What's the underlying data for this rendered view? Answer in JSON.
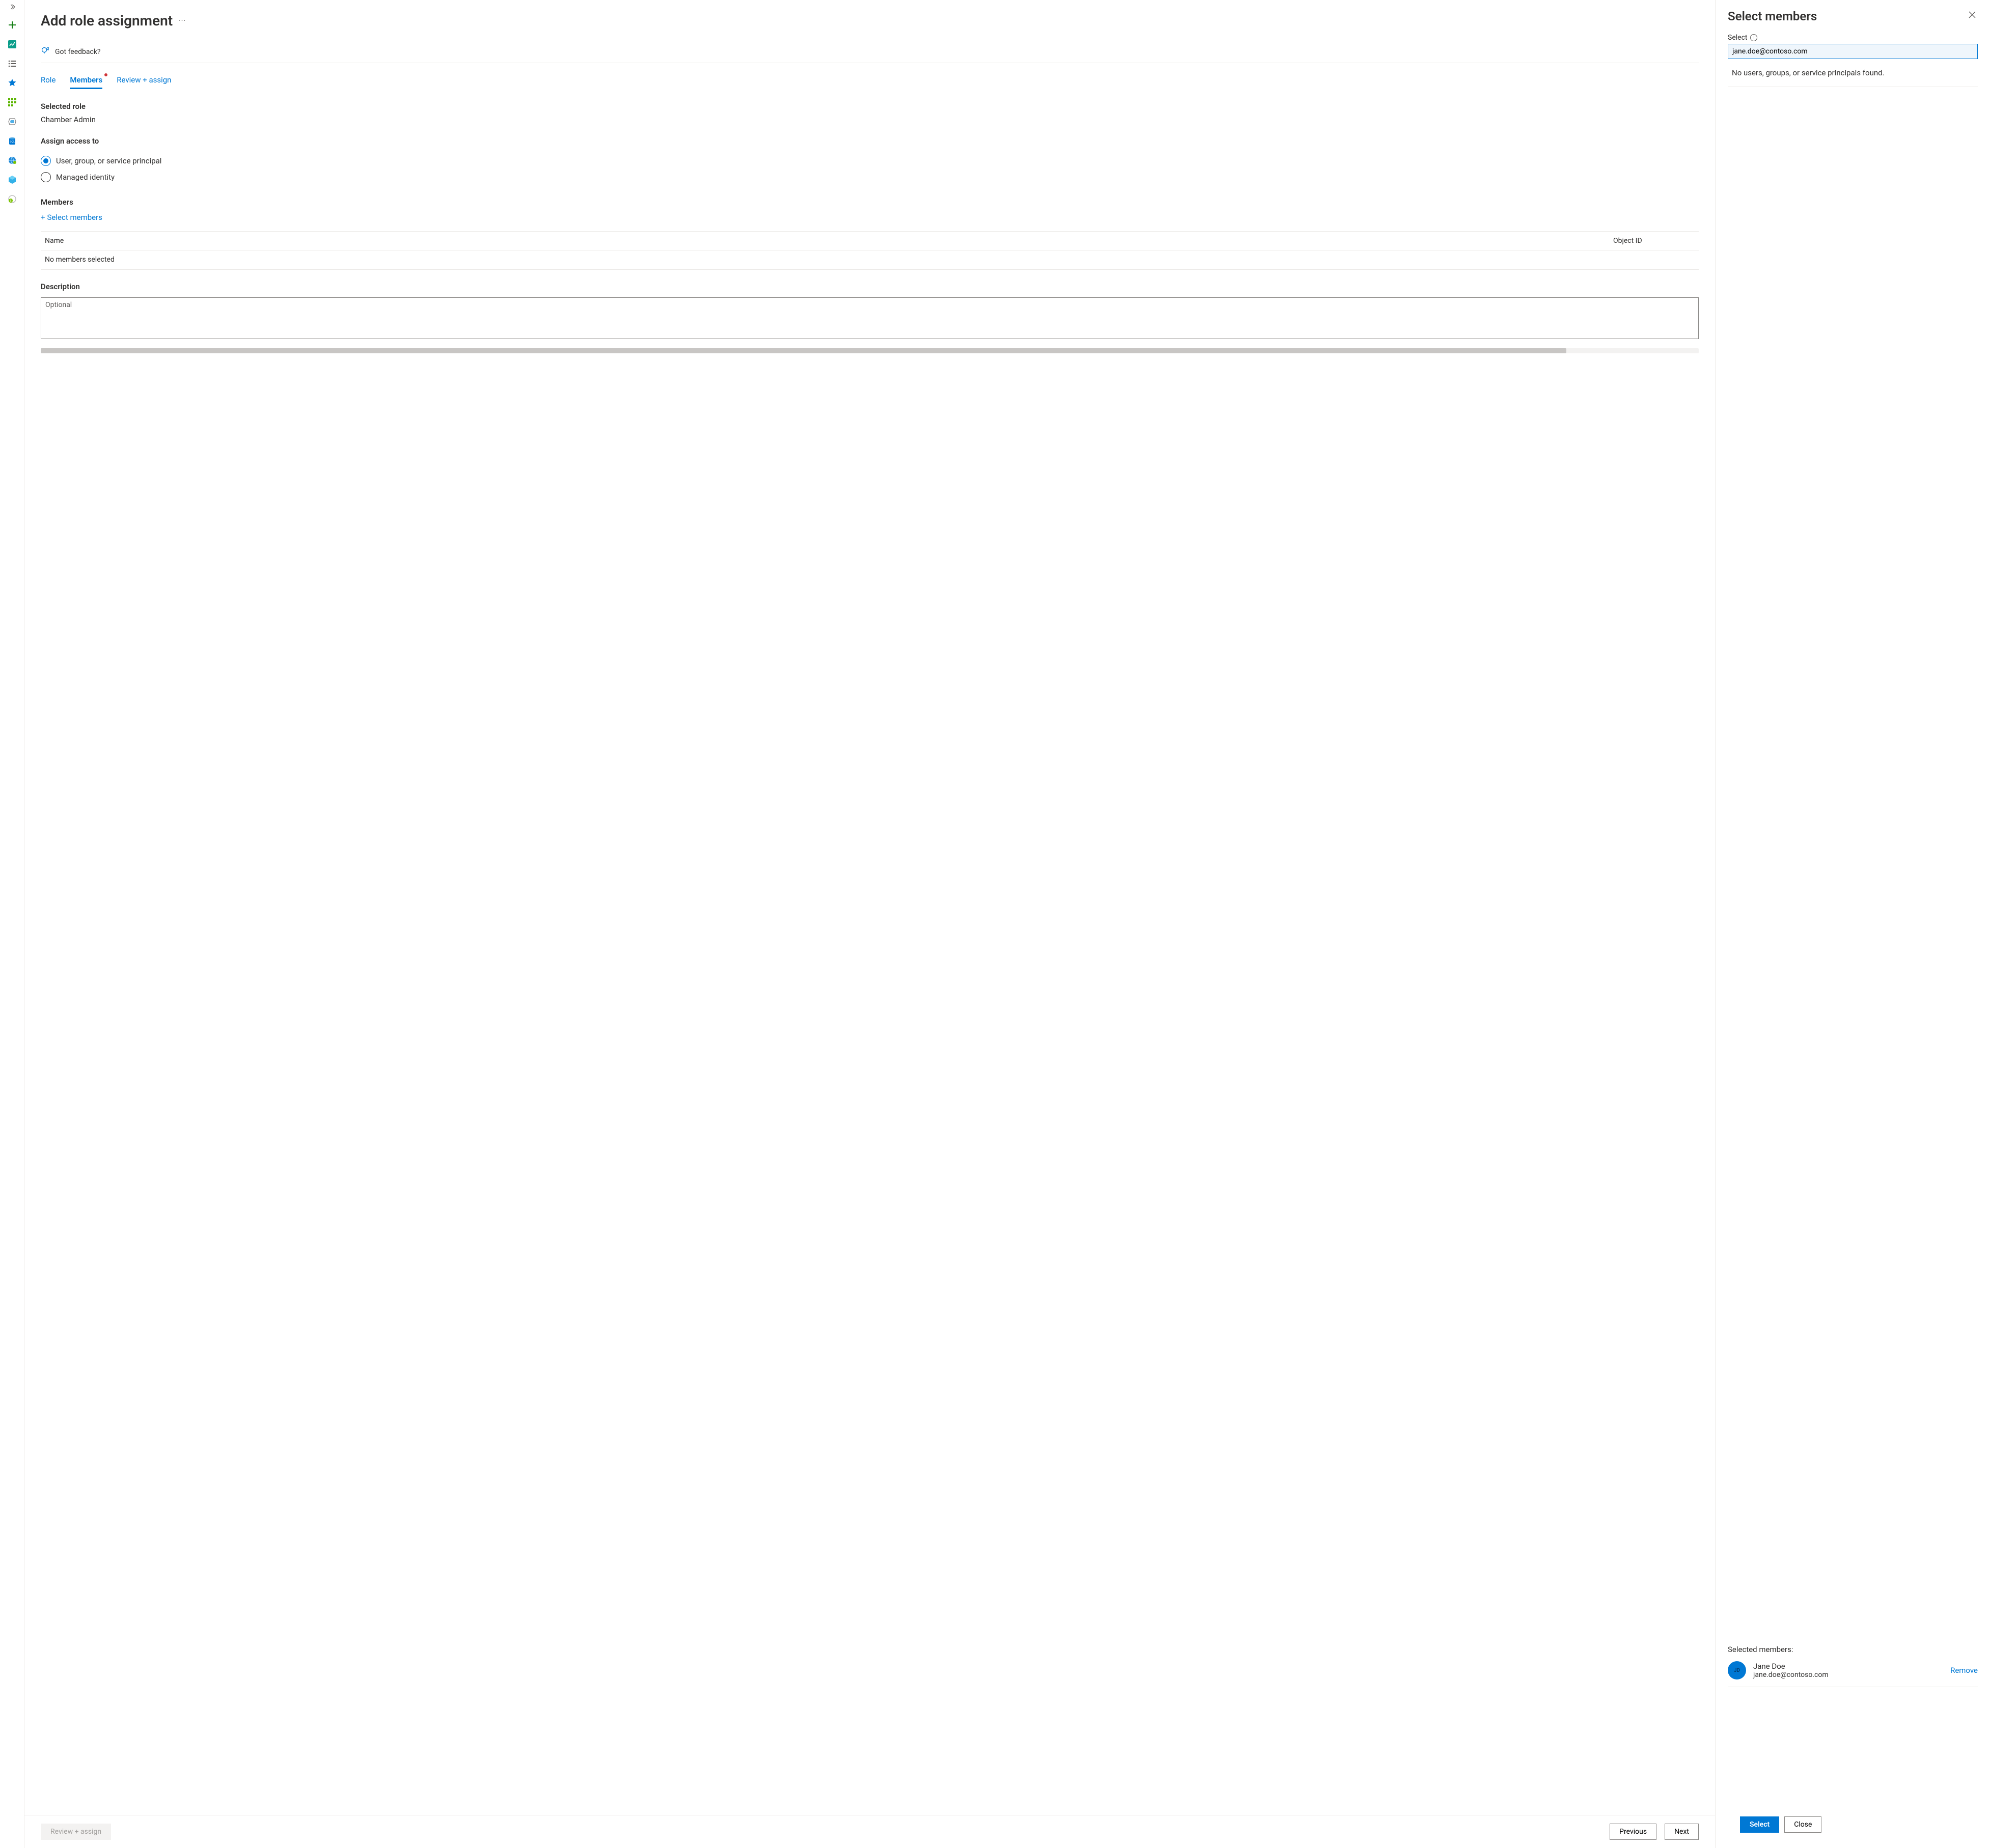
{
  "rail": {
    "icons": [
      {
        "name": "create-icon",
        "glyph": "plus",
        "color": "#107c10"
      },
      {
        "name": "dashboard-icon",
        "glyph": "chart",
        "color": "#0078d4"
      },
      {
        "name": "list-icon",
        "glyph": "list",
        "color": "#605e5c"
      },
      {
        "name": "favorites-icon",
        "glyph": "star",
        "color": "#0078d4"
      },
      {
        "name": "grid-icon",
        "glyph": "grid",
        "color": "#107c10"
      },
      {
        "name": "hex-icon",
        "glyph": "hex",
        "color": "#808080"
      },
      {
        "name": "sql-icon",
        "glyph": "sql",
        "color": "#0078d4"
      },
      {
        "name": "globe-icon",
        "glyph": "globe",
        "color": "#0078d4"
      },
      {
        "name": "cube-icon",
        "glyph": "cube",
        "color": "#32b1e8"
      },
      {
        "name": "cost-icon",
        "glyph": "cost",
        "color": "#107c10"
      }
    ]
  },
  "page": {
    "title": "Add role assignment",
    "feedback": "Got feedback?"
  },
  "tabs": {
    "role": "Role",
    "members": "Members",
    "review": "Review + assign",
    "active": "members",
    "members_has_dot": true
  },
  "selected_role": {
    "label": "Selected role",
    "value": "Chamber Admin"
  },
  "assign_access": {
    "label": "Assign access to",
    "options": {
      "ugsp": "User, group, or service principal",
      "mi": "Managed identity"
    },
    "selected": "ugsp"
  },
  "members": {
    "label": "Members",
    "select_link": "Select members",
    "table": {
      "col_name": "Name",
      "col_id": "Object ID",
      "empty": "No members selected"
    }
  },
  "description": {
    "label": "Description",
    "placeholder": "Optional",
    "value": ""
  },
  "footer": {
    "review": "Review + assign",
    "previous": "Previous",
    "next": "Next"
  },
  "flyout": {
    "title": "Select members",
    "select_label": "Select",
    "search_value": "jane.doe@contoso.com",
    "no_results": "No users, groups, or service principals found.",
    "selected_label": "Selected members:",
    "member": {
      "initials": "JD",
      "name": "Jane Doe",
      "email": "jane.doe@contoso.com"
    },
    "remove": "Remove",
    "select_btn": "Select",
    "close_btn": "Close"
  }
}
